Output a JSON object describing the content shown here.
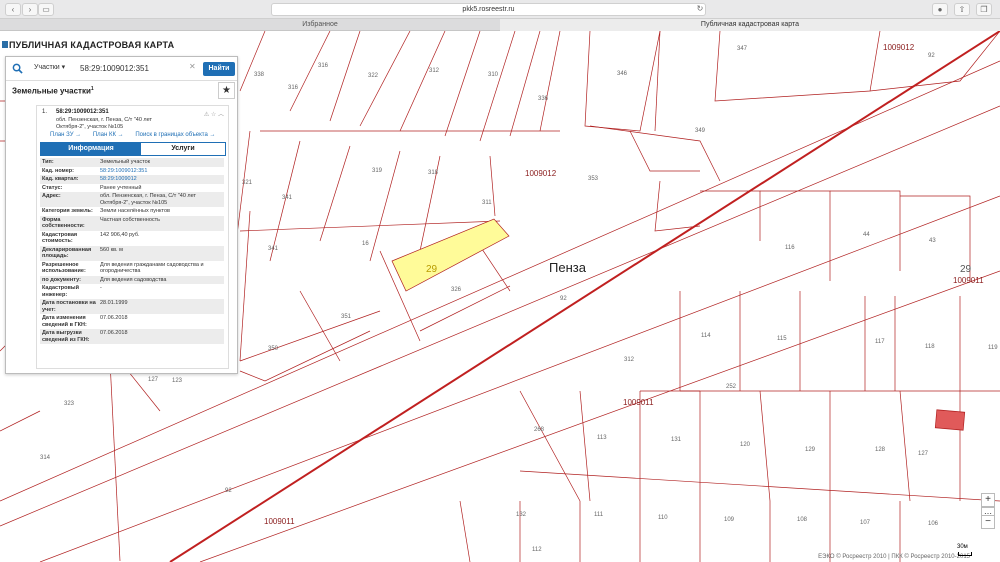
{
  "browser": {
    "url": "pkk5.rosreestr.ru",
    "tabs": [
      "Избранное",
      "Публичная кадастровая карта"
    ]
  },
  "app": {
    "title": "ПУБЛИЧНАЯ КАДАСТРОВАЯ КАРТА"
  },
  "search": {
    "type_label": "Участки",
    "query": "58:29:1009012:351",
    "find_label": "Найти"
  },
  "results": {
    "section_title": "Земельные участки",
    "count": "1",
    "item_index": "1.",
    "cad_number": "58:29:1009012:351",
    "address": "обл. Пензенская, г. Пенза, С/т \"40 лет Октября-2\", участок №105",
    "links": {
      "plan_zu": "План ЗУ",
      "plan_kk": "План КК",
      "search_in_bounds": "Поиск в границах объекта"
    },
    "tabs": {
      "info": "Информация",
      "services": "Услуги"
    },
    "rows": [
      {
        "label": "Тип:",
        "value": "Земельный участок",
        "link": false
      },
      {
        "label": "Кад. номер:",
        "value": "58:29:1009012:351",
        "link": true
      },
      {
        "label": "Кад. квартал:",
        "value": "58:29:1009012",
        "link": true
      },
      {
        "label": "Статус:",
        "value": "Ранее учтенный",
        "link": false
      },
      {
        "label": "Адрес:",
        "value": "обл. Пензенская, г. Пенза, С/т \"40 лет Октября-2\", участок №105",
        "link": false
      },
      {
        "label": "Категория земель:",
        "value": "Земли населённых пунктов",
        "link": false
      },
      {
        "label": "Форма собственности:",
        "value": "Частная собственность",
        "link": false
      },
      {
        "label": "Кадастровая стоимость:",
        "value": "142 906,40 руб.",
        "link": false
      },
      {
        "label": "Декларированная площадь:",
        "value": "560 кв. м",
        "link": false
      },
      {
        "label": "Разрешенное использование:",
        "value": "Для ведения гражданами садоводства и огородничества",
        "link": false
      },
      {
        "label": "по документу:",
        "value": "Для ведения садоводства",
        "link": false
      },
      {
        "label": "Кадастровый инженер:",
        "value": "-",
        "link": false
      },
      {
        "label": "Дата постановки на учет:",
        "value": "28.01.1999",
        "link": false
      },
      {
        "label": "Дата изменения сведений в ГКН:",
        "value": "07.06.2018",
        "link": false
      },
      {
        "label": "Дата выгрузки сведений из ГКН:",
        "value": "07.06.2018",
        "link": false
      }
    ]
  },
  "map": {
    "city": "Пенза",
    "city_left": "Пе",
    "selected_label": "29",
    "block_labels": [
      "1009012",
      "1009012",
      "1009011",
      "1009011",
      "1009011"
    ],
    "big_29": "29",
    "parcel_numbers": [
      "338",
      "316",
      "322",
      "312",
      "310",
      "336",
      "346",
      "347",
      "92",
      "316",
      "321",
      "319",
      "318",
      "341",
      "341",
      "311",
      "353",
      "349",
      "116",
      "44",
      "43",
      "326",
      "350",
      "312",
      "123",
      "114",
      "115",
      "117",
      "118",
      "119",
      "127",
      "314",
      "92",
      "268",
      "113",
      "131",
      "120",
      "129",
      "128",
      "127",
      "132",
      "111",
      "110",
      "109",
      "108",
      "107",
      "106",
      "112",
      "252",
      "351",
      "16",
      "92",
      "150",
      "323"
    ],
    "copyright": "ЕЭКО © Росреестр 2010 | ПКК © Росреестр 2010-2015",
    "scale_label": "30м"
  },
  "colors": {
    "accent": "#1f6fb5",
    "parcel_line": "#b02020",
    "selected_fill": "#fffb99",
    "highlight_red": "#e05a5a"
  }
}
